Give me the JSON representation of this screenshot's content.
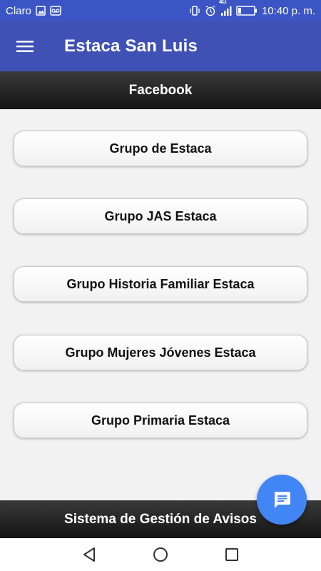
{
  "status_bar": {
    "carrier": "Claro",
    "network": "4G",
    "time": "10:40 p. m.",
    "icons": [
      "image-icon",
      "voicemail-icon",
      "vibrate-icon",
      "alarm-icon",
      "signal-icon",
      "battery-icon"
    ]
  },
  "app_bar": {
    "title": "Estaca San Luis",
    "menu_icon": "hamburger-menu-icon"
  },
  "section": {
    "title": "Facebook"
  },
  "links": [
    {
      "label": "Grupo de Estaca"
    },
    {
      "label": "Grupo JAS Estaca"
    },
    {
      "label": "Grupo Historia Familiar Estaca"
    },
    {
      "label": "Grupo Mujeres Jóvenes Estaca"
    },
    {
      "label": "Grupo Primaria Estaca"
    }
  ],
  "footer": {
    "title": "Sistema de Gestión de Avisos"
  },
  "fab": {
    "icon": "chat-icon"
  },
  "nav_bar": {
    "icons": [
      "back-icon",
      "home-icon",
      "recents-icon"
    ]
  },
  "colors": {
    "app_bar": "#3f51b5",
    "status_bar": "#3b56c4",
    "fab": "#4285f4",
    "header_dark": "#1a1a1a",
    "content_bg": "#f2f2f2"
  }
}
